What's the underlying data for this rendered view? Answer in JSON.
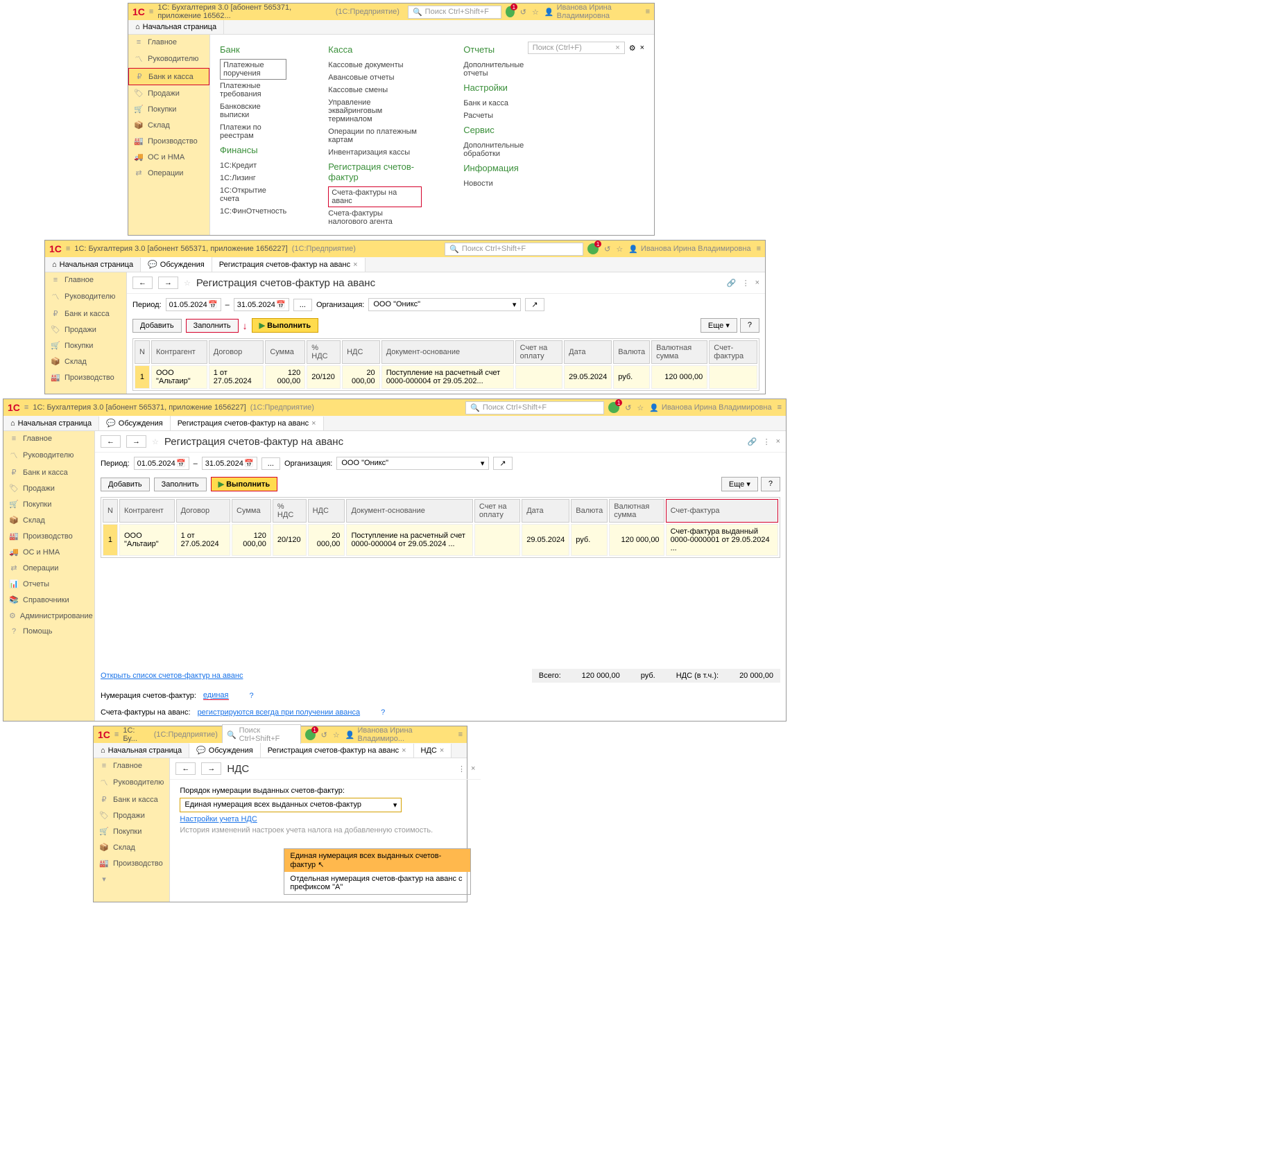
{
  "app": {
    "logo": "1C",
    "title": "1С: Бухгалтерия 3.0 [абонент 565371, приложение 16562...",
    "title2": "1С: Бухгалтерия 3.0 [абонент 565371, приложение 1656227]",
    "mode": "(1С:Предприятие)",
    "titleShort": "1С: Бу...",
    "search": "Поиск Ctrl+Shift+F",
    "user": "Иванова Ирина Владимировна",
    "userShort": "Иванова Ирина Владимиро..."
  },
  "tabs": {
    "home": "Начальная страница",
    "discuss": "Обсуждения",
    "reg": "Регистрация счетов-фактур на аванс",
    "nds": "НДС"
  },
  "sidebar": {
    "main": "Главное",
    "boss": "Руководителю",
    "bank": "Банк и касса",
    "sales": "Продажи",
    "buy": "Покупки",
    "stock": "Склад",
    "prod": "Производство",
    "os": "ОС и НМА",
    "ops": "Операции",
    "reports": "Отчеты",
    "refs": "Справочники",
    "admin": "Администрирование",
    "help": "Помощь"
  },
  "menu1": {
    "bank": {
      "hdr": "Банк",
      "i1": "Платежные поручения",
      "i2": "Платежные требования",
      "i3": "Банковские выписки",
      "i4": "Платежи по реестрам"
    },
    "fin": {
      "hdr": "Финансы",
      "i1": "1С:Кредит",
      "i2": "1С:Лизинг",
      "i3": "1С:Открытие счета",
      "i4": "1С:ФинОтчетность"
    },
    "kassa": {
      "hdr": "Касса",
      "i1": "Кассовые документы",
      "i2": "Авансовые отчеты",
      "i3": "Кассовые смены",
      "i4": "Управление эквайринговым терминалом",
      "i5": "Операции по платежным картам",
      "i6": "Инвентаризация кассы"
    },
    "regsf": {
      "hdr": "Регистрация счетов-фактур",
      "i1": "Счета-фактуры на аванс",
      "i2": "Счета-фактуры налогового агента"
    },
    "reports": {
      "hdr": "Отчеты",
      "i1": "Дополнительные отчеты"
    },
    "settings": {
      "hdr": "Настройки",
      "i1": "Банк и касса",
      "i2": "Расчеты"
    },
    "service": {
      "hdr": "Сервис",
      "i1": "Дополнительные обработки"
    },
    "info": {
      "hdr": "Информация",
      "i1": "Новости"
    },
    "rightSearch": "Поиск (Ctrl+F)"
  },
  "regPage": {
    "title": "Регистрация счетов-фактур на аванс",
    "periodLbl": "Период:",
    "from": "01.05.2024",
    "to": "31.05.2024",
    "orgLbl": "Организация:",
    "org": "ООО \"Оникс\"",
    "add": "Добавить",
    "fill": "Заполнить",
    "run": "Выполнить",
    "more": "Еще",
    "q": "?",
    "cols": {
      "n": "N",
      "kontr": "Контрагент",
      "dog": "Договор",
      "sum": "Сумма",
      "pcnds": "% НДС",
      "nds": "НДС",
      "doc": "Документ-основание",
      "bill": "Счет на оплату",
      "date": "Дата",
      "cur": "Валюта",
      "cursum": "Валютная сумма",
      "sf": "Счет-фактура"
    },
    "row": {
      "n": "1",
      "kontr": "ООО \"Альтаир\"",
      "dog": "1 от 27.05.2024",
      "sum": "120 000,00",
      "pcnds": "20/120",
      "nds": "20 000,00",
      "doc": "Поступление на расчетный счет 0000-000004 от 29.05.202...",
      "doc2": "Поступление на расчетный счет 0000-000004 от 29.05.2024 ...",
      "date": "29.05.2024",
      "cur": "руб.",
      "cursum": "120 000,00",
      "sf": "Счет-фактура выданный 0000-0000001 от 29.05.2024 ..."
    },
    "openList": "Открыть список счетов-фактур на аванс",
    "numLbl": "Нумерация счетов-фактур:",
    "numVal": "единая",
    "sfLbl": "Счета-фактуры на аванс:",
    "sfVal": "регистрируются всегда при получении аванса",
    "totals": {
      "lbl": "Всего:",
      "sum": "120 000,00",
      "cur": "руб.",
      "ndsLbl": "НДС (в т.ч.):",
      "nds": "20 000,00"
    }
  },
  "ndsPage": {
    "title": "НДС",
    "orderLbl": "Порядок нумерации выданных счетов-фактур:",
    "orderVal": "Единая нумерация всех выданных счетов-фактур",
    "settingsLink": "Настройки учета НДС",
    "hint": "История изменений настроек учета налога на добавленную стоимость.",
    "opt1": "Единая нумерация всех выданных счетов-фактур",
    "opt2": "Отдельная нумерация счетов-фактур на аванс с префиксом \"А\""
  }
}
